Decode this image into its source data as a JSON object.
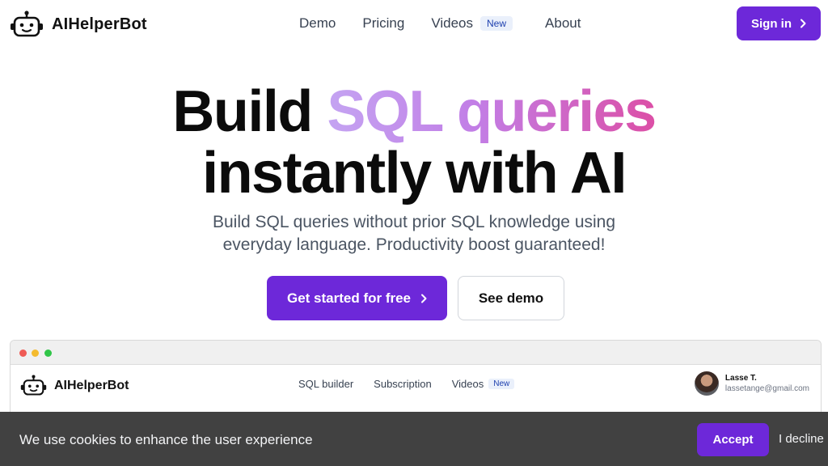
{
  "header": {
    "brand": "AIHelperBot",
    "nav": [
      {
        "label": "Demo"
      },
      {
        "label": "Pricing"
      },
      {
        "label": "Videos",
        "badge": "New"
      },
      {
        "label": "About"
      }
    ],
    "signin_label": "Sign in"
  },
  "hero": {
    "title_part1": "Build",
    "title_highlight": "SQL queries",
    "title_line2": "instantly with AI",
    "subtitle_line1": "Build SQL queries without prior SQL knowledge using",
    "subtitle_line2": "everyday language. Productivity boost guaranteed!",
    "cta_primary": "Get started for free",
    "cta_secondary": "See demo"
  },
  "mockup": {
    "brand": "AIHelperBot",
    "nav": [
      {
        "label": "SQL builder"
      },
      {
        "label": "Subscription"
      },
      {
        "label": "Videos",
        "badge": "New"
      }
    ],
    "user": {
      "name": "Lasse T.",
      "email": "lassetange@gmail.com"
    }
  },
  "cookie": {
    "message": "We use cookies to enhance the user experience",
    "accept_label": "Accept",
    "decline_label": "I decline"
  },
  "colors": {
    "accent": "#6d28d9",
    "gradient_start": "#c4a4f2",
    "gradient_end": "#dc4fa6",
    "cookie_bg": "#414141"
  }
}
